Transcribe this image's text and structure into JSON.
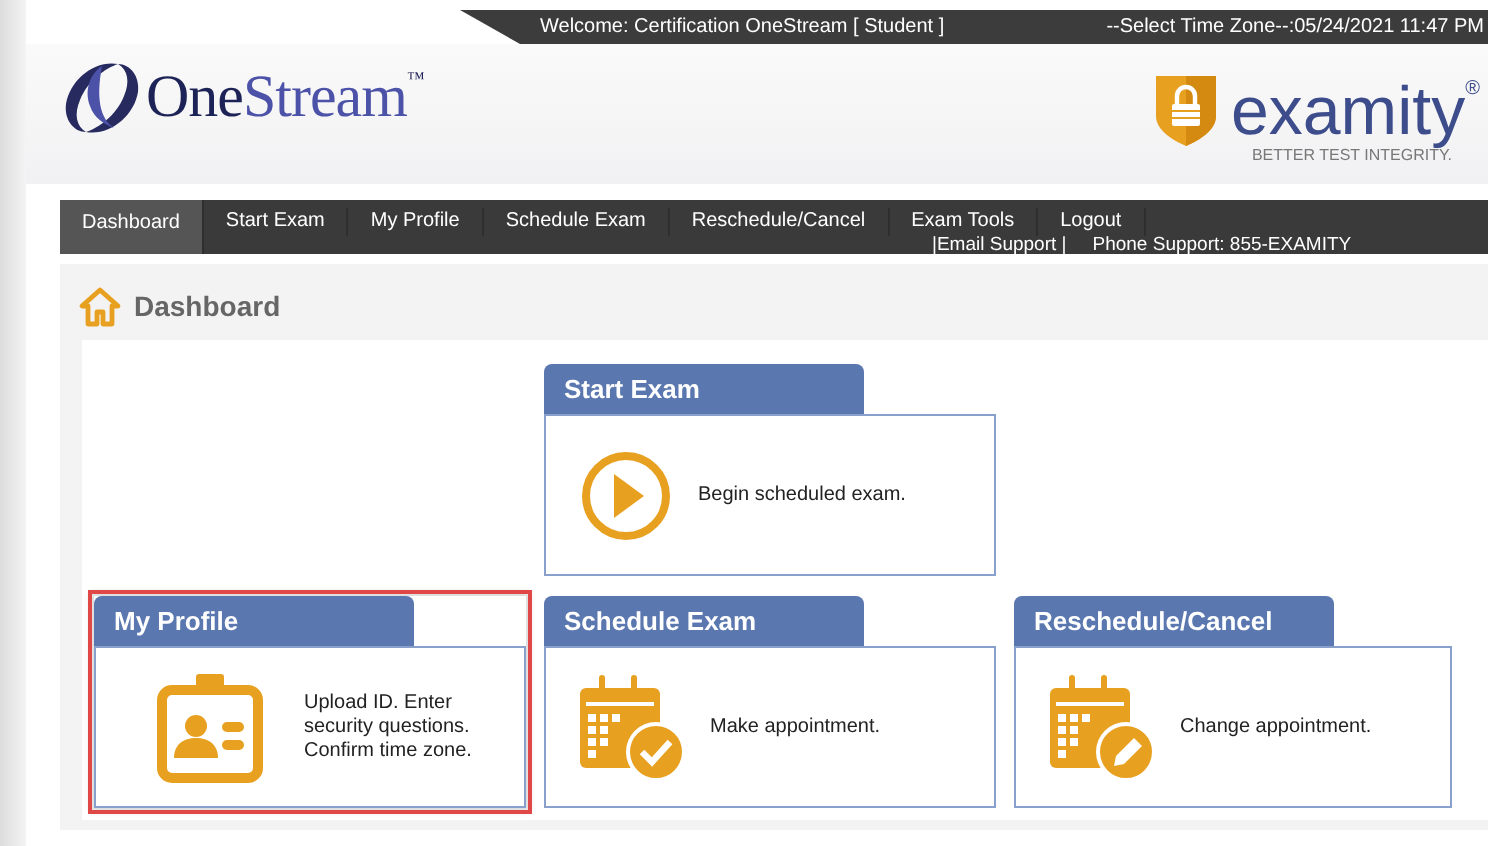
{
  "top_bar": {
    "welcome": "Welcome: Certification OneStream [ Student ]",
    "time_zone": "--Select Time Zone--:05/24/2021 11:47 PM"
  },
  "brand": {
    "parts": [
      "One",
      "Stream"
    ],
    "trademark": "™"
  },
  "partner": {
    "name": "examity",
    "registered": "®",
    "tagline": "BETTER TEST INTEGRITY."
  },
  "nav": {
    "items": [
      {
        "label": "Dashboard",
        "selected": true
      },
      {
        "label": "Start Exam",
        "selected": false
      },
      {
        "label": "My Profile",
        "selected": false
      },
      {
        "label": "Schedule Exam",
        "selected": false
      },
      {
        "label": "Reschedule/Cancel",
        "selected": false
      },
      {
        "label": "Exam Tools",
        "selected": false
      },
      {
        "label": "Logout",
        "selected": false
      }
    ],
    "support": [
      "|Email Support |",
      "Phone Support: 855-EXAMITY"
    ]
  },
  "page_title": "Dashboard",
  "featured_card": {
    "title": "Start Exam",
    "kind": "play",
    "text": "Begin scheduled exam.",
    "highlighted": false
  },
  "cards": [
    {
      "title": "My Profile",
      "kind": "profile",
      "text": "Upload ID. Enter security questions. Confirm time zone.",
      "highlighted": true
    },
    {
      "title": "Schedule Exam",
      "kind": "schedule",
      "text": "Make appointment.",
      "highlighted": false
    },
    {
      "title": "Reschedule/Cancel",
      "kind": "reschedule",
      "text": "Change appointment.",
      "highlighted": false
    }
  ]
}
